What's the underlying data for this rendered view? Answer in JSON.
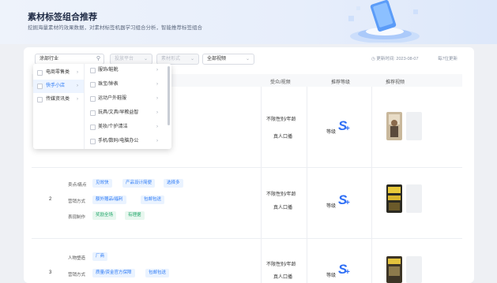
{
  "header": {
    "title": "素材标签组合推荐",
    "subtitle": "挖掘海量素材的效果数据，对素材标签机器学习组合分析，智能推荐标签组合"
  },
  "filters": {
    "industry_value": "涂部行业",
    "filter2": "投放平台",
    "filter3": "素材形式",
    "filter4": "全部视频"
  },
  "meta": {
    "update_time": "更新时间: 2023-08-07",
    "page_info": "每7位更新"
  },
  "table": {
    "headers": [
      "受众/视频",
      "推荐等级",
      "推荐视频"
    ]
  },
  "rows": [
    {
      "index": "",
      "audience": "不限性别/年龄",
      "video_type": "真人口播",
      "grade_label": "等级",
      "grade": "S",
      "plus": "+",
      "labels": []
    },
    {
      "index": "2",
      "audience": "不限性别/年龄",
      "video_type": "真人口播",
      "grade_label": "等级",
      "grade": "S",
      "plus": "+",
      "labels": [
        {
          "key": "卖点/痛点",
          "tags": [
            "见效快",
            "产品设计简便",
            "选择多"
          ],
          "color": "blue"
        },
        {
          "key": "营销方式",
          "tags": [
            "额外赠品/福利",
            "包邮包送"
          ],
          "color": "blue"
        },
        {
          "key": "表现制作",
          "tags": [
            "奖励全场",
            "有理据"
          ],
          "color": "green"
        }
      ]
    },
    {
      "index": "3",
      "audience": "不限性别/年龄",
      "video_type": "真人口播",
      "grade_label": "等级",
      "grade": "S",
      "plus": "+",
      "labels": [
        {
          "key": "人物塑造",
          "tags": [
            "厂商"
          ],
          "color": "blue"
        },
        {
          "key": "营销方式",
          "tags": [
            "质量/资金官方保障",
            "包邮包送"
          ],
          "color": "blue"
        }
      ]
    }
  ],
  "dropdown": {
    "level1": [
      {
        "label": "电商零售类",
        "active": false
      },
      {
        "label": "快手小店",
        "active": true
      },
      {
        "label": "传媒资讯类",
        "active": false
      }
    ],
    "level2": [
      "服饰/鞋靴",
      "珠宝/钟表",
      "运动户外鞋服",
      "玩具/文具/早教益智",
      "美妆/个护清洁",
      "手机/数码/电脑办公"
    ]
  },
  "colors": {
    "accent": "#2f7cf6",
    "grade": "#2f6ff5",
    "tag_green": "#21a66a"
  }
}
